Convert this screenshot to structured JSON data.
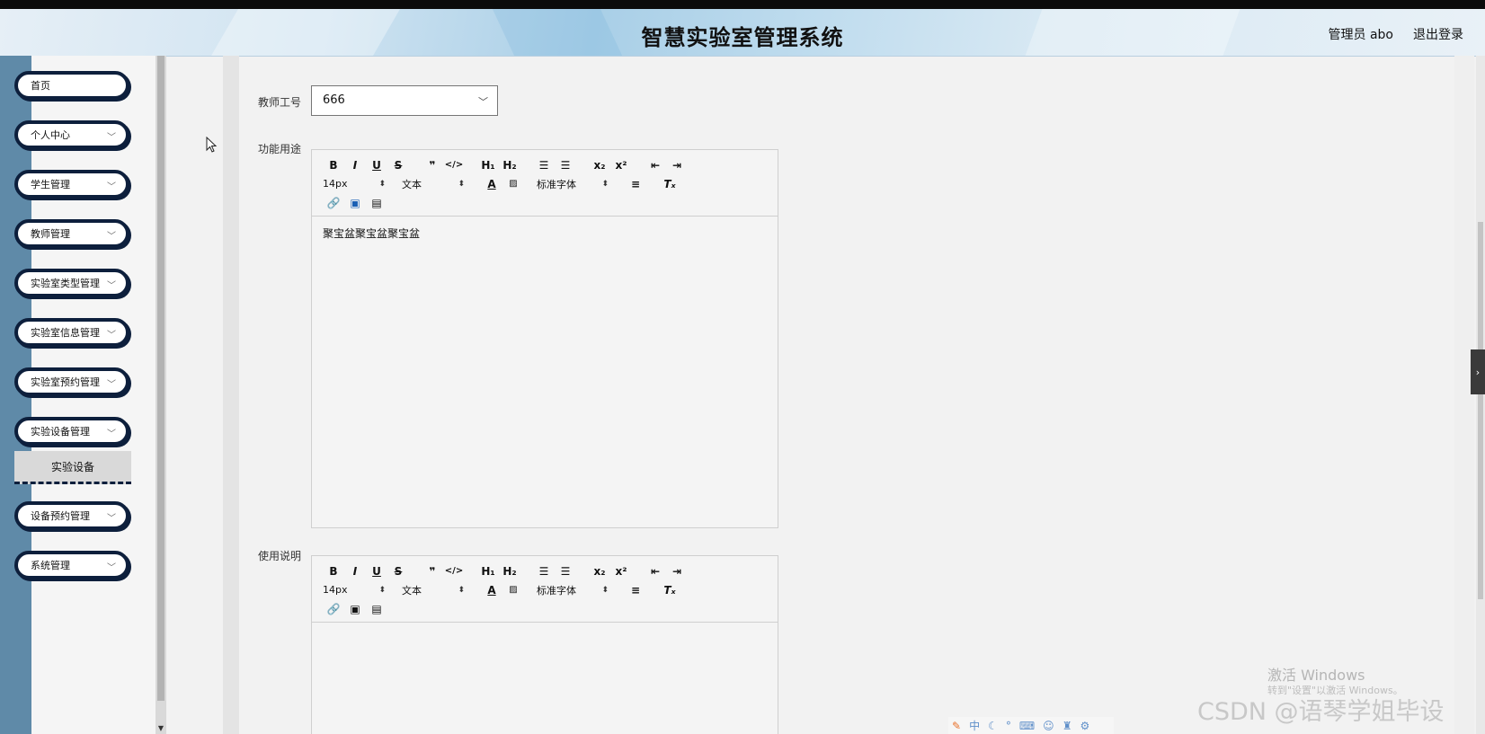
{
  "header": {
    "title": "智慧实验室管理系统",
    "user_label": "管理员 abo",
    "logout_label": "退出登录"
  },
  "sidebar": {
    "items": [
      {
        "label": "首页",
        "has_chevron": false
      },
      {
        "label": "个人中心",
        "has_chevron": true
      },
      {
        "label": "学生管理",
        "has_chevron": true
      },
      {
        "label": "教师管理",
        "has_chevron": true
      },
      {
        "label": "实验室类型管理",
        "has_chevron": true
      },
      {
        "label": "实验室信息管理",
        "has_chevron": true
      },
      {
        "label": "实验室预约管理",
        "has_chevron": true
      },
      {
        "label": "实验设备管理",
        "has_chevron": true
      },
      {
        "label": "设备预约管理",
        "has_chevron": true
      },
      {
        "label": "系统管理",
        "has_chevron": true
      }
    ],
    "active_submenu": "实验设备"
  },
  "form": {
    "teacher_id_label": "教师工号",
    "teacher_id_value": "666",
    "function_label": "功能用途",
    "function_content": "聚宝盆聚宝盆聚宝盆",
    "usage_label": "使用说明",
    "usage_content": ""
  },
  "editor_toolbar": {
    "font_size": "14px",
    "paragraph": "文本",
    "font_family": "标准字体",
    "buttons": [
      "bold-icon",
      "italic-icon",
      "underline-icon",
      "strike-icon",
      "quote-icon",
      "code-icon",
      "h1-icon",
      "h2-icon",
      "ordered-list-icon",
      "bullet-list-icon",
      "subscript-icon",
      "superscript-icon",
      "outdent-icon",
      "indent-icon",
      "font-color-icon",
      "background-color-icon",
      "align-icon",
      "clear-format-icon",
      "link-icon",
      "image-icon",
      "video-icon"
    ]
  },
  "watermarks": {
    "windows_line1": "激活 Windows",
    "windows_line2": "转到\"设置\"以激活 Windows。",
    "csdn": "CSDN @语琴学姐毕设"
  },
  "ime": {
    "label": "中"
  }
}
